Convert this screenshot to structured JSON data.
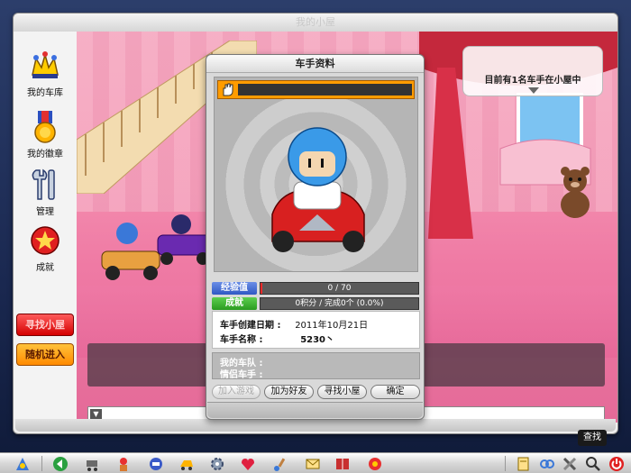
{
  "window": {
    "title": "我的小屋"
  },
  "sidebar": {
    "items": [
      {
        "label": "我的车库",
        "icon": "garage-crown-icon"
      },
      {
        "label": "我的徽章",
        "icon": "medal-icon"
      },
      {
        "label": "管理",
        "icon": "tools-icon"
      },
      {
        "label": "成就",
        "icon": "achievement-icon"
      }
    ],
    "find_house_label": "寻找小屋",
    "random_enter_label": "随机进入"
  },
  "scene": {
    "occupancy_text": "目前有1名车手在小屋中"
  },
  "dialog": {
    "title": "车手资料",
    "exp_label": "经验值",
    "exp_text": "0 / 70",
    "exp_progress": 0.0,
    "achievement_label": "成就",
    "achievement_text": "0积分 / 完成0个  (0.0%)",
    "created_label": "车手创建日期 :",
    "created_value": "2011年10月21日",
    "name_label": "车手名称 :",
    "name_value": "5230丶",
    "team_label": "我的车队 :",
    "partner_label": "情侣车手 :",
    "buttons": {
      "join_game": "加入游戏",
      "add_friend": "加为好友",
      "find_house": "寻找小屋",
      "confirm": "确定"
    }
  },
  "taskbar": {
    "tooltip": "查找"
  },
  "colors": {
    "scene_pink": "#f48fb0",
    "exp_tag": "#2f58c4",
    "achievement_tag": "#2a9b20",
    "name_bar": "#ff9c00"
  }
}
